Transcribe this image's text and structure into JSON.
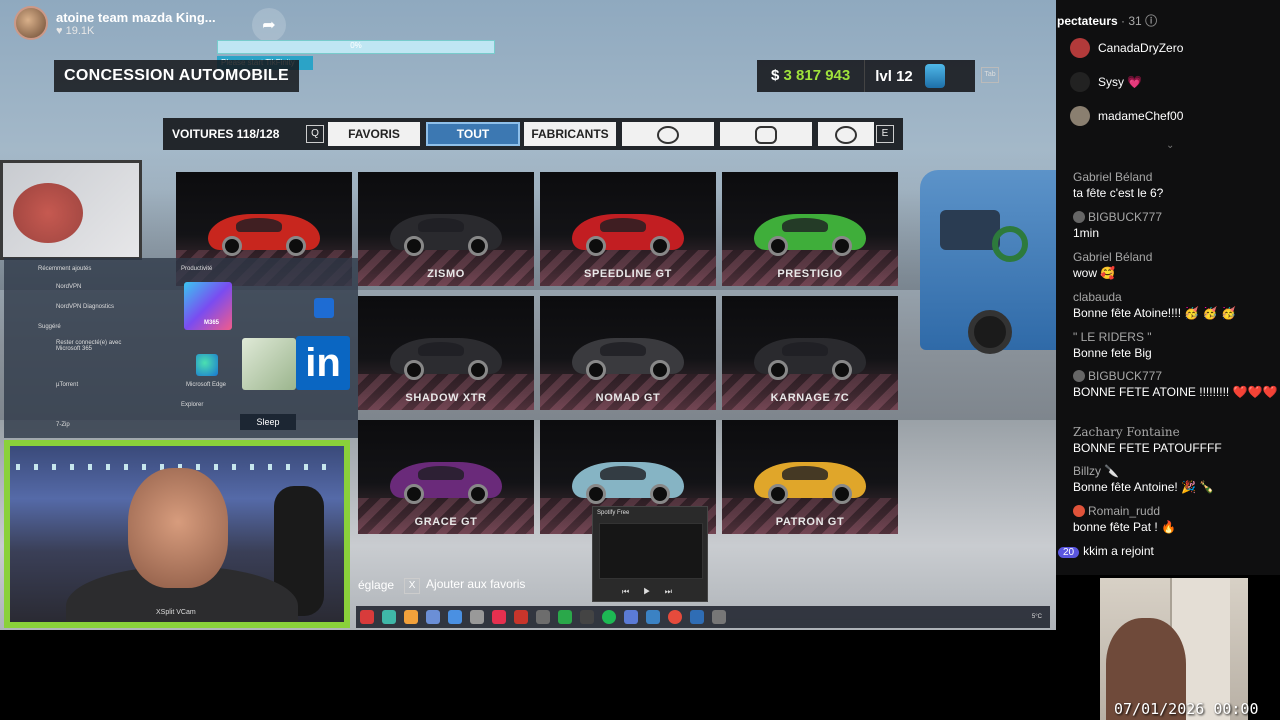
{
  "stream": {
    "title": "atoine team mazda King...",
    "likes": "♥ 19.1K",
    "share_icon": "share-arrow-icon",
    "progress_percent": 0,
    "progress_label": "0%",
    "tip": "Please start TikFinity"
  },
  "game": {
    "dealership_title": "CONCESSION AUTOMOBILE",
    "money_prefix": "$ ",
    "money": "3 817 943",
    "level": "lvl 12",
    "tab_key": "Tab",
    "filter": {
      "count": "VOITURES 118/128",
      "key_left": "Q",
      "key_right": "E",
      "tabs": [
        {
          "label": "FAVORIS",
          "active": false
        },
        {
          "label": "TOUT",
          "active": true
        },
        {
          "label": "FABRICANTS",
          "active": false
        }
      ],
      "icon_tabs": [
        "wheel-icon",
        "car-front-icon",
        "engine-icon"
      ]
    },
    "cars": [
      {
        "name": "",
        "color": "#c8261e"
      },
      {
        "name": "ZISMO",
        "color": "#2a2a2e"
      },
      {
        "name": "SPEEDLINE GT",
        "color": "#c21e22"
      },
      {
        "name": "PRESTIGIO",
        "color": "#3fae3a"
      },
      {
        "name": "SHADOW XTR",
        "color": "#2c2c30"
      },
      {
        "name": "NOMAD GT",
        "color": "#3a3a3e"
      },
      {
        "name": "KARNAGE 7C",
        "color": "#2a2a2e"
      },
      {
        "name": "GRACE GT",
        "color": "#6a2a7a"
      },
      {
        "name": "",
        "color": "#86b4c4"
      },
      {
        "name": "PATRON GT",
        "color": "#e0a62a"
      }
    ],
    "footer": {
      "settings": "églage",
      "fav_key": "X",
      "fav_label": "Ajouter aux favoris"
    }
  },
  "desktop": {
    "recent_header": "Récemment ajoutés",
    "productivity_header": "Productivité",
    "recent": [
      "NordVPN",
      "NordVPN Diagnostics"
    ],
    "suggested_header": "Suggéré",
    "suggested": [
      "Rester connecté(e) avec Microsoft 365",
      "µTorrent",
      "7-Zip"
    ],
    "tiles": {
      "copilot": "Microsoft 365",
      "edge": "Microsoft Edge",
      "linkedin": "in",
      "m365": "M365"
    },
    "explorer": "Explorer",
    "sleep": "Sleep",
    "webcam_watermark": "XSplit VCam",
    "spotify_title": "Spotify Free",
    "spotify_controls": "⏮ ▶ ⏭",
    "tray_temp": "5°C"
  },
  "chat": {
    "viewers_label": "pectateurs",
    "viewers_count": "· 31",
    "viewers": [
      {
        "name": "CanadaDryZero",
        "color": "#b23a3a"
      },
      {
        "name": "Sysy 💗",
        "color": "#222"
      },
      {
        "name": "madameChef00",
        "color": "#8a7f70"
      }
    ],
    "messages": [
      {
        "user": "Gabriel Béland",
        "text": "ta fête c'est le 6?"
      },
      {
        "user": "BIGBUCK777",
        "text": "1min"
      },
      {
        "user": "Gabriel Béland",
        "text": "wow 🥰"
      },
      {
        "user": "clabauda",
        "text": "Bonne fête Atoine!!!! 🥳 🥳 🥳"
      },
      {
        "user": "\" LE RIDERS \"",
        "text": "Bonne fete Big"
      },
      {
        "user": "BIGBUCK777",
        "text": "BONNE FETE ATOINE !!!!!!!!! ❤️❤️❤️"
      },
      {
        "user": "Zachary Fontaine",
        "text": "BONNE FETE PATOUFFFF"
      },
      {
        "user": "Billzy 🔪",
        "text": "Bonne fête Antoine! 🎉 🍾"
      },
      {
        "user": "Romain_rudd",
        "text": "bonne fête Pat ! 🔥"
      }
    ],
    "join_badge": "20",
    "join_user": "kkim",
    "join_text": "a rejoint"
  },
  "timestamp": "07/01/2026 00:00"
}
